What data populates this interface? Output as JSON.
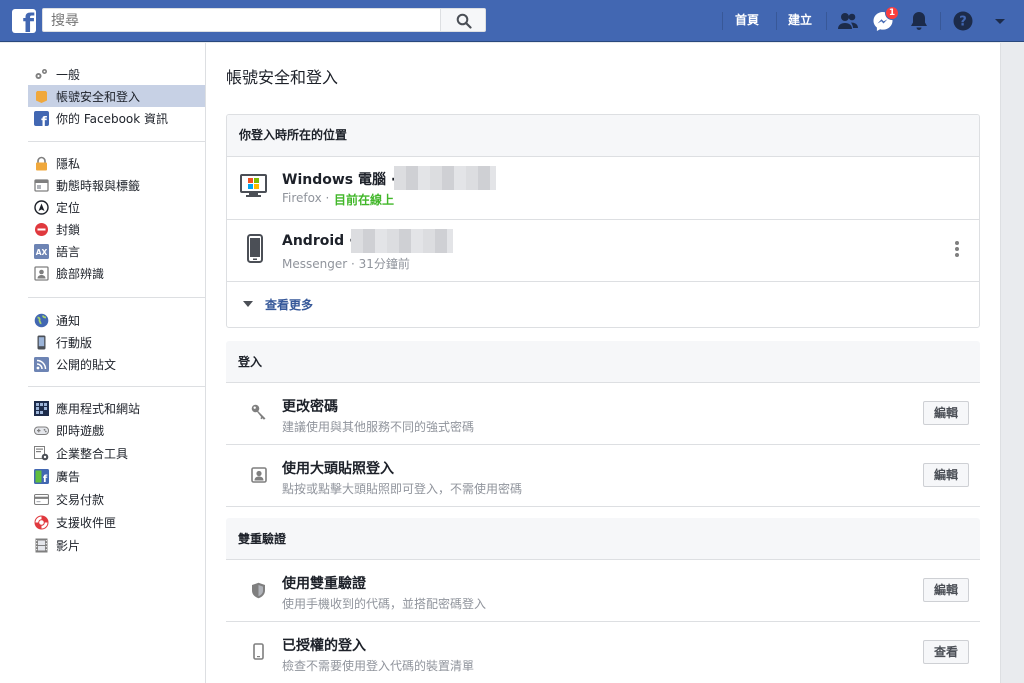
{
  "topbar": {
    "search_placeholder": "搜尋",
    "home": "首頁",
    "create": "建立",
    "messenger_badge": "1",
    "icons": [
      "friends-icon",
      "messenger-icon",
      "notifications-icon",
      "help-icon",
      "menu-arrow-icon"
    ]
  },
  "sidebar": {
    "group1": [
      "一般",
      "帳號安全和登入",
      "你的 Facebook 資訊"
    ],
    "group2": [
      "隱私",
      "動態時報與標籤",
      "定位",
      "封鎖",
      "語言",
      "臉部辨識"
    ],
    "group3": [
      "通知",
      "行動版",
      "公開的貼文"
    ],
    "group4": [
      "應用程式和網站",
      "即時遊戲",
      "企業整合工具",
      "廣告",
      "交易付款",
      "支援收件匣",
      "影片"
    ]
  },
  "main": {
    "title": "帳號安全和登入",
    "locations": {
      "header": "你登入時所在的位置",
      "devices": [
        {
          "name": "Windows 電腦 ·",
          "app": "Firefox ·",
          "status": "目前在線上"
        },
        {
          "name": "Android ·",
          "app": "Messenger · 31分鐘前"
        }
      ],
      "see_more": "查看更多"
    },
    "login": {
      "header": "登入",
      "items": [
        {
          "title": "更改密碼",
          "desc": "建議使用與其他服務不同的強式密碼",
          "button": "編輯"
        },
        {
          "title": "使用大頭貼照登入",
          "desc": "點按或點擊大頭貼照即可登入，不需使用密碼",
          "button": "編輯"
        }
      ]
    },
    "two_factor": {
      "header": "雙重驗證",
      "items": [
        {
          "title": "使用雙重驗證",
          "desc": "使用手機收到的代碼，並搭配密碼登入",
          "button": "編輯"
        },
        {
          "title": "已授權的登入",
          "desc": "檢查不需要使用登入代碼的裝置清單",
          "button": "查看"
        }
      ]
    }
  },
  "colors": {
    "brand": "#4267b2",
    "online": "#42b72a",
    "link": "#365899",
    "badge": "#fa3e3e"
  }
}
